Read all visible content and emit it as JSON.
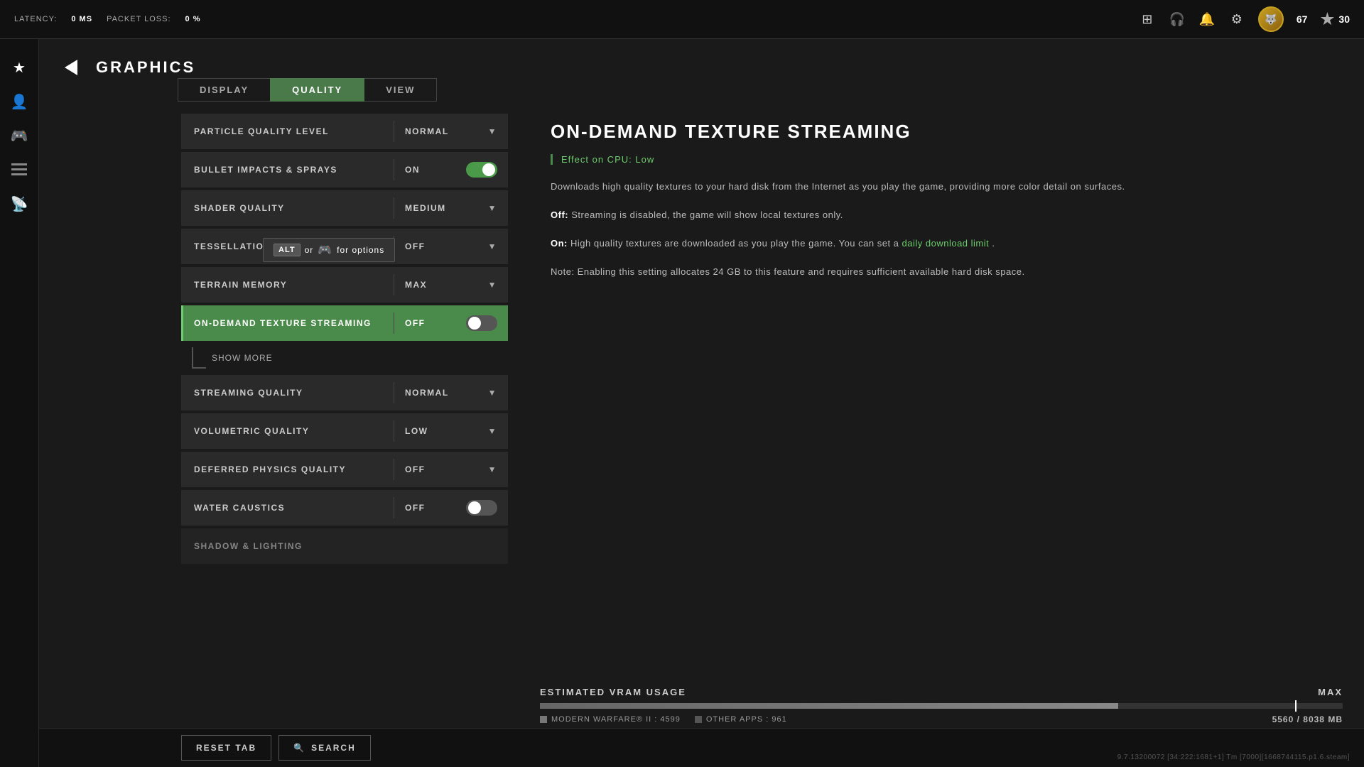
{
  "topbar": {
    "latency_label": "LATENCY:",
    "latency_value": "0 MS",
    "packet_loss_label": "PACKET LOSS:",
    "packet_loss_value": "0 %",
    "user_level": "67",
    "token_count": "30"
  },
  "header": {
    "page_title": "GRAPHICS",
    "back_label": "‹"
  },
  "tabs": [
    {
      "id": "display",
      "label": "DISPLAY",
      "active": false
    },
    {
      "id": "quality",
      "label": "QUALITY",
      "active": true
    },
    {
      "id": "view",
      "label": "VIEW",
      "active": false
    }
  ],
  "settings": [
    {
      "id": "particle-quality",
      "label": "PARTICLE QUALITY LEVEL",
      "value": "NORMAL",
      "type": "dropdown",
      "selected": false
    },
    {
      "id": "bullet-impacts",
      "label": "BULLET IMPACTS & SPRAYS",
      "value": "ON",
      "type": "toggle",
      "toggle_state": "on",
      "selected": false
    },
    {
      "id": "shader-quality",
      "label": "SHADER QUALITY",
      "value": "MEDIUM",
      "type": "dropdown",
      "selected": false
    },
    {
      "id": "tessellation",
      "label": "TESSELLATION",
      "value": "OFF",
      "type": "dropdown",
      "selected": false
    },
    {
      "id": "terrain-memory",
      "label": "TERRAIN MEMORY",
      "value": "MAX",
      "type": "dropdown",
      "selected": false
    },
    {
      "id": "on-demand-streaming",
      "label": "ON-DEMAND TEXTURE STREAMING",
      "value": "OFF",
      "type": "toggle",
      "toggle_state": "off",
      "selected": true
    },
    {
      "id": "streaming-quality",
      "label": "STREAMING QUALITY",
      "value": "NORMAL",
      "type": "dropdown",
      "selected": false
    },
    {
      "id": "volumetric-quality",
      "label": "VOLUMETRIC QUALITY",
      "value": "LOW",
      "type": "dropdown",
      "selected": false
    },
    {
      "id": "deferred-physics",
      "label": "DEFERRED PHYSICS QUALITY",
      "value": "OFF",
      "type": "dropdown",
      "selected": false
    },
    {
      "id": "water-caustics",
      "label": "WATER CAUSTICS",
      "value": "OFF",
      "type": "toggle",
      "toggle_state": "off",
      "selected": false
    },
    {
      "id": "shadow-lighting",
      "label": "SHADOW & LIGHTING",
      "value": "",
      "type": "dropdown",
      "selected": false
    }
  ],
  "show_more": {
    "label": "SHOW MORE"
  },
  "tooltip": {
    "prefix": "or",
    "kbd1": "ALT",
    "suffix": "for options",
    "controller_icon": "🎮"
  },
  "info_panel": {
    "title": "ON-DEMAND TEXTURE STREAMING",
    "effect_label": "Effect on CPU:",
    "effect_value": "Low",
    "description1": "Downloads high quality textures to your hard disk from the Internet as you play the game, providing more color detail on surfaces.",
    "description2_prefix": "Off:",
    "description2_text": " Streaming is disabled, the game will show local textures only.",
    "description3_prefix": "On:",
    "description3_text": " High quality textures are downloaded as you play the game. You can set a ",
    "description3_link": "daily download limit",
    "description3_suffix": ".",
    "description4": "Note: Enabling this setting allocates 24 GB to this feature and requires sufficient available hard disk space."
  },
  "vram": {
    "title": "ESTIMATED VRAM USAGE",
    "max_label": "MAX",
    "bar_fill_percent": 72,
    "game_label": "MODERN WARFARE® II",
    "game_value": "4599",
    "other_label": "OTHER APPS",
    "other_value": "961",
    "usage_current": "5560",
    "usage_max": "8038",
    "usage_unit": "MB"
  },
  "bottom": {
    "reset_tab_label": "RESET TAB",
    "search_icon": "🔍",
    "search_label": "SEARCH"
  },
  "version": "9.7.13200072 [34:222:1681+1] Tm [7000][1668744115.p1.6.steam]",
  "sidebar_icons": [
    "★",
    "👤",
    "🎮",
    "≡",
    "📡"
  ]
}
